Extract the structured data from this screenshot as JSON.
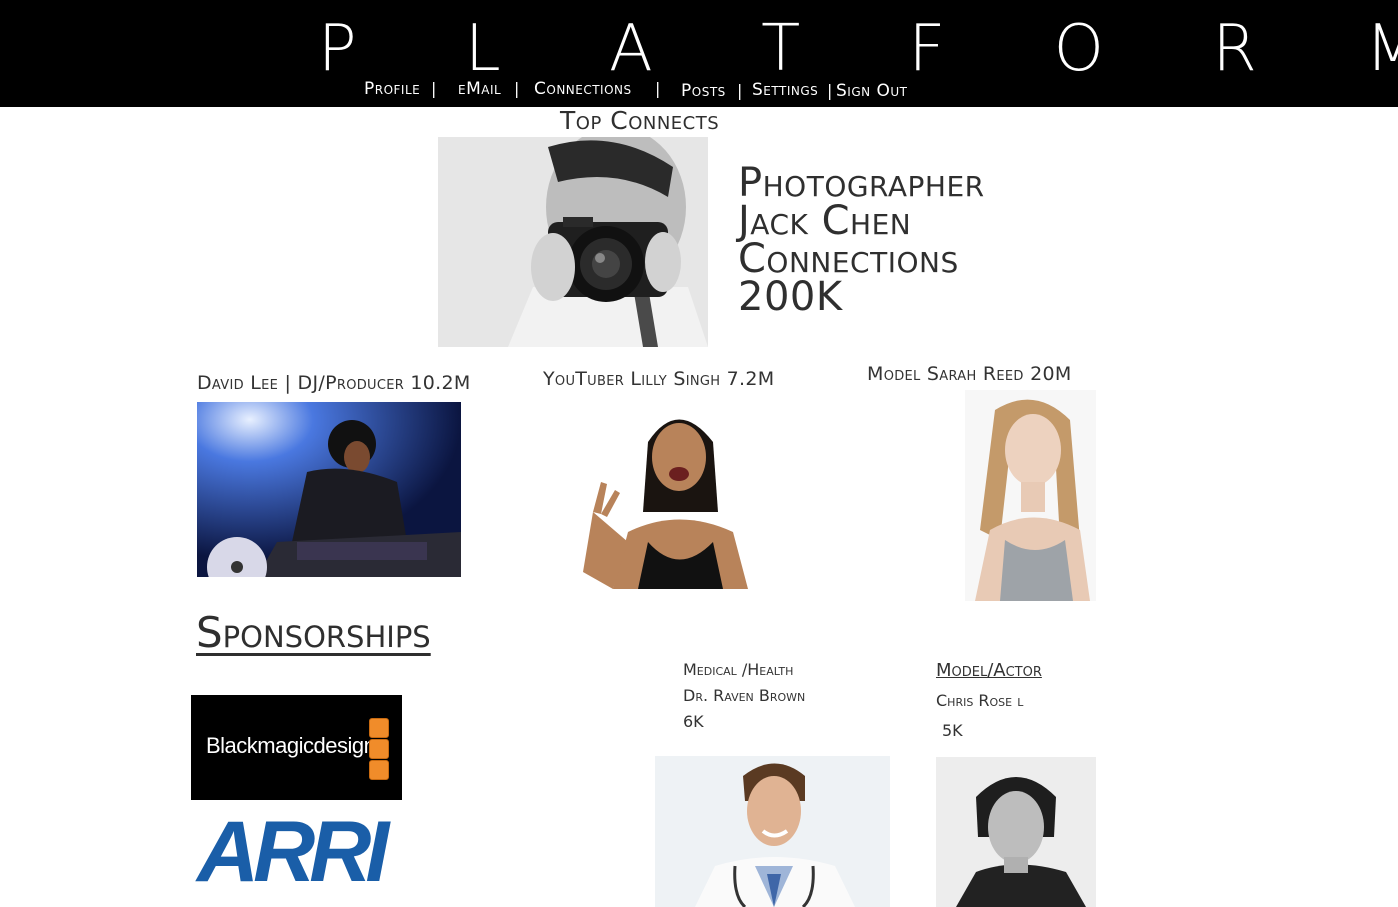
{
  "header": {
    "logo": "P L A T F O R M",
    "nav": [
      {
        "label": "Profile"
      },
      {
        "label": "eMail"
      },
      {
        "label": "Connections"
      },
      {
        "label": "Posts"
      },
      {
        "label": "Settings"
      },
      {
        "label": "Sign Out"
      }
    ],
    "separator": "|"
  },
  "top_connects": {
    "title": "Top Connects",
    "feature": {
      "role": "Photographer",
      "name": "Jack Chen",
      "connections_label": "Connections",
      "connections_value": "200K"
    },
    "cards": [
      {
        "title": "David Lee  | DJ/Producer 10.2M"
      },
      {
        "title": "YouTuber Lilly Singh 7.2M"
      },
      {
        "title": "Model Sarah Reed  20M"
      }
    ]
  },
  "sponsorships": {
    "title": "Sponsorships",
    "sponsors": [
      "Blackmagicdesign",
      "ARRI"
    ]
  },
  "profiles": [
    {
      "category": "Medical /Health",
      "name": "Dr. Raven Brown",
      "count": "6K"
    },
    {
      "category": "Model/Actor",
      "name": "Chris Rose l",
      "count": "5K"
    }
  ],
  "colors": {
    "header_bg": "#000000",
    "text": "#2f2f2f",
    "bmd_orange": "#f08c2a",
    "arri_blue": "#1a5ea8"
  }
}
